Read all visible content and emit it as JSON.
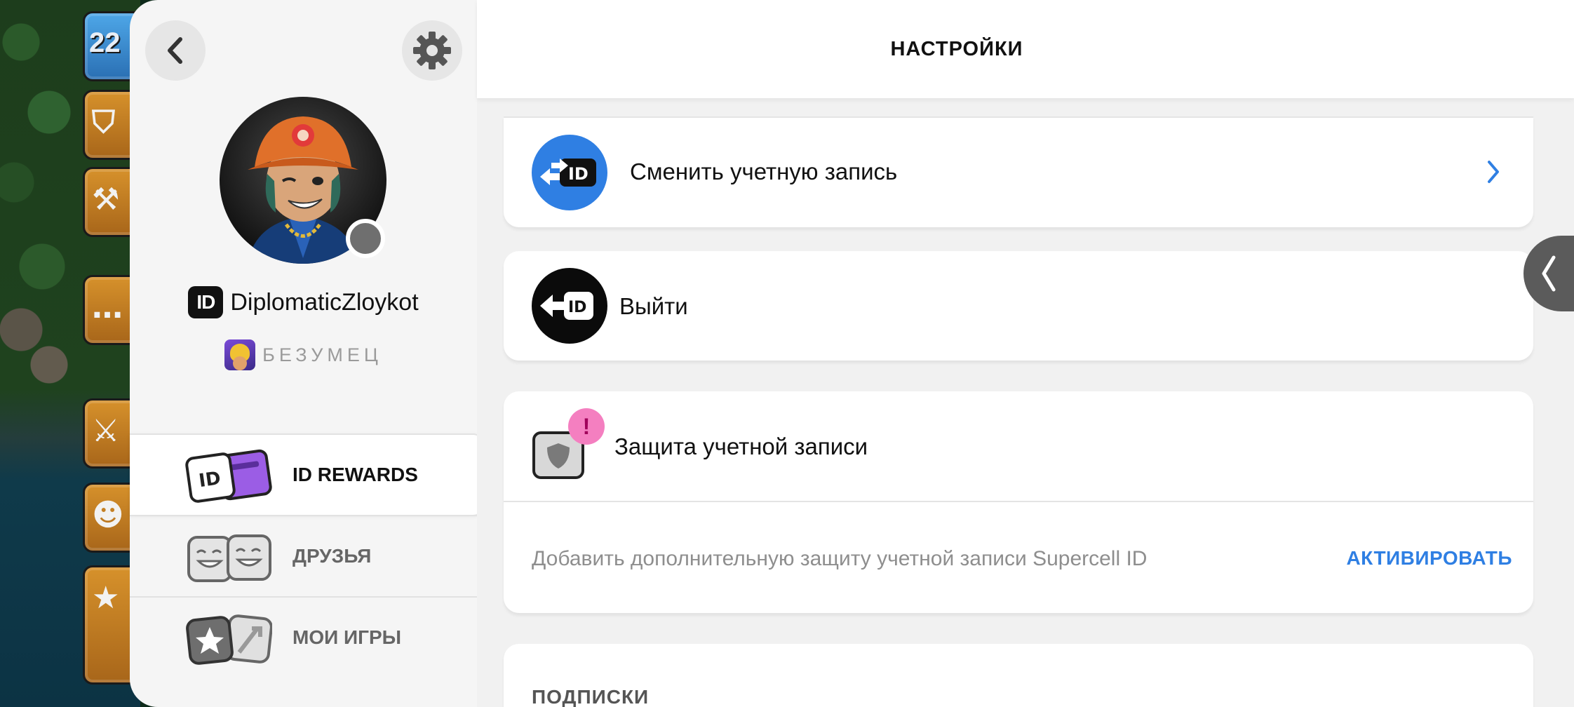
{
  "game_background": {
    "tile_number": "22"
  },
  "side_panel": {
    "username": "DiplomaticZloykot",
    "id_badge": "ID",
    "rank_label": "БЕЗУМЕЦ",
    "menu": [
      {
        "label": "ID REWARDS",
        "icon": "id-rewards-icon",
        "active": true
      },
      {
        "label": "ДРУЗЬЯ",
        "icon": "friends-icon",
        "active": false
      },
      {
        "label": "МОИ ИГРЫ",
        "icon": "my-games-icon",
        "active": false
      }
    ]
  },
  "header": {
    "title": "НАСТРОЙКИ"
  },
  "settings": {
    "switch_account": {
      "label": "Сменить учетную запись",
      "icon": "switch-account-icon"
    },
    "logout": {
      "label": "Выйти",
      "icon": "logout-icon"
    },
    "account_protection": {
      "label": "Защита учетной записи",
      "alert_badge": "!",
      "hint": "Добавить дополнительную защиту учетной записи Supercell ID",
      "action": "АКТИВИРОВАТЬ"
    },
    "subscriptions_heading": "ПОДПИСКИ"
  },
  "colors": {
    "accent_blue": "#2f7fe3",
    "alert_pink": "#f47fc0",
    "panel_bg": "#f5f5f5",
    "main_bg": "#f1f1f1"
  }
}
